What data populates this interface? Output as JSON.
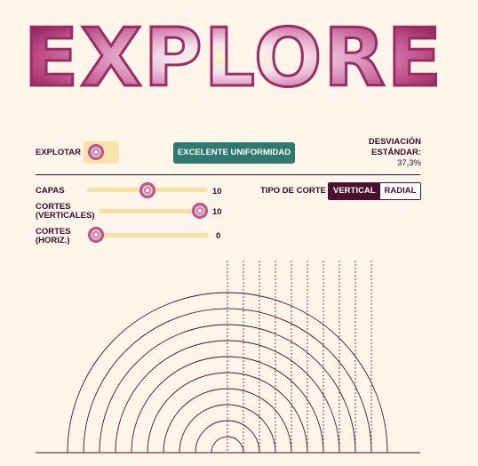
{
  "header": {
    "title": "EXPLORE"
  },
  "controls": {
    "explode_label": "EXPLOTAR",
    "uniformity_badge": "EXCELENTE UNIFORMIDAD",
    "deviation_label_1": "DESVIACIÓN",
    "deviation_label_2": "ESTÁNDAR:",
    "deviation_value": "37,3%",
    "layers_label": "CAPAS",
    "layers_value": "10",
    "layers_fraction": 0.5,
    "vertical_cuts_label_1": "CORTES",
    "vertical_cuts_label_2": "(VERTICALES)",
    "vertical_cuts_value": "10",
    "vertical_cuts_fraction": 1.0,
    "horiz_cuts_label_1": "CORTES",
    "horiz_cuts_label_2": "(HORIZ.)",
    "horiz_cuts_value": "0",
    "horiz_cuts_fraction": 0.0,
    "cut_type_label": "TIPO DE CORTE",
    "cut_type_options": [
      "VERTICAL",
      "RADIAL"
    ],
    "cut_type_selected": "VERTICAL"
  },
  "diagram": {
    "layers": 10,
    "vertical_cuts": 10,
    "horizontal_cuts": 0
  },
  "colors": {
    "background": "#fdf5ea",
    "accent": "#4a1030",
    "badge": "#2f7a6e",
    "track": "#f8e0a2",
    "onion": "#b6487f"
  }
}
